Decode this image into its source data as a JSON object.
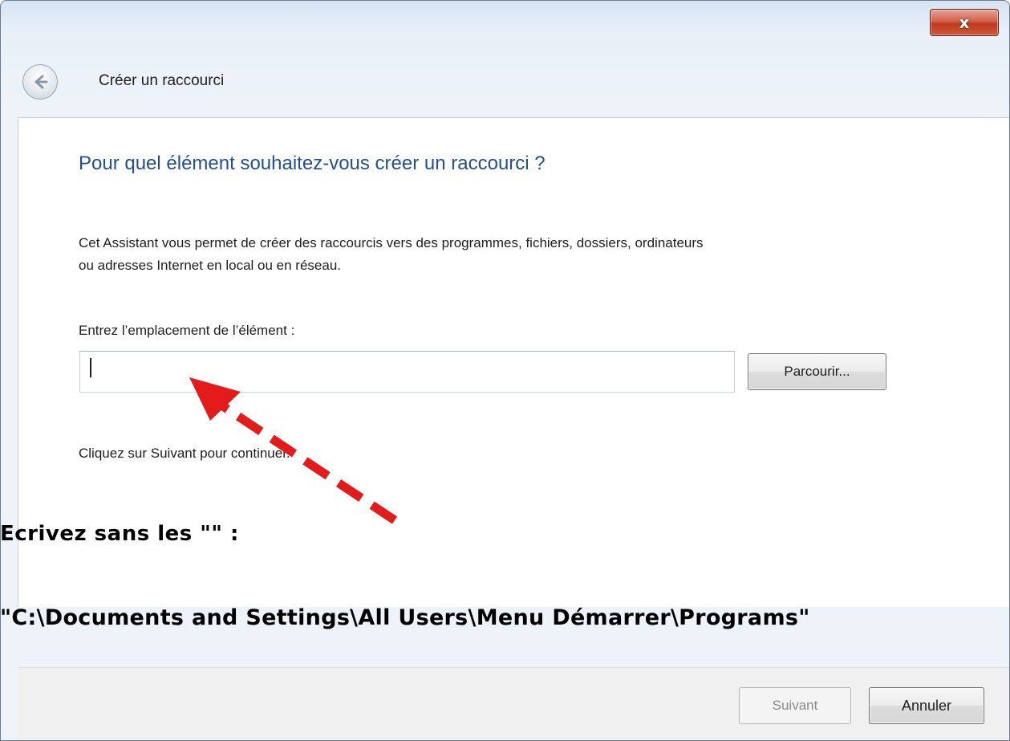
{
  "window": {
    "close_label": "x",
    "close_icon": "close-icon"
  },
  "header": {
    "back_icon": "back-arrow-icon",
    "title": "Créer un raccourci"
  },
  "content": {
    "question": "Pour quel élément souhaitez-vous créer un raccourci ?",
    "description_line1": "Cet Assistant vous permet de créer des raccourcis vers des programmes, fichiers, dossiers, ordinateurs",
    "description_line2": "ou adresses Internet en local ou en réseau.",
    "location_label": "Entrez l’emplacement de l’élément :",
    "location_value": "",
    "browse_label": "Parcourir...",
    "continue_text": "Cliquez sur Suivant pour continuer."
  },
  "annotation": {
    "line1": "Ecrivez sans les \"\" :",
    "line2": "\"C:\\Documents and Settings\\All Users\\Menu Démarrer\\Programs\"",
    "arrow_color": "#e31b1b",
    "arrow_icon": "red-dashed-arrow-icon"
  },
  "footer": {
    "next_label": "Suivant",
    "cancel_label": "Annuler"
  },
  "colors": {
    "question_blue": "#1f4f96",
    "close_red": "#c0391f"
  }
}
